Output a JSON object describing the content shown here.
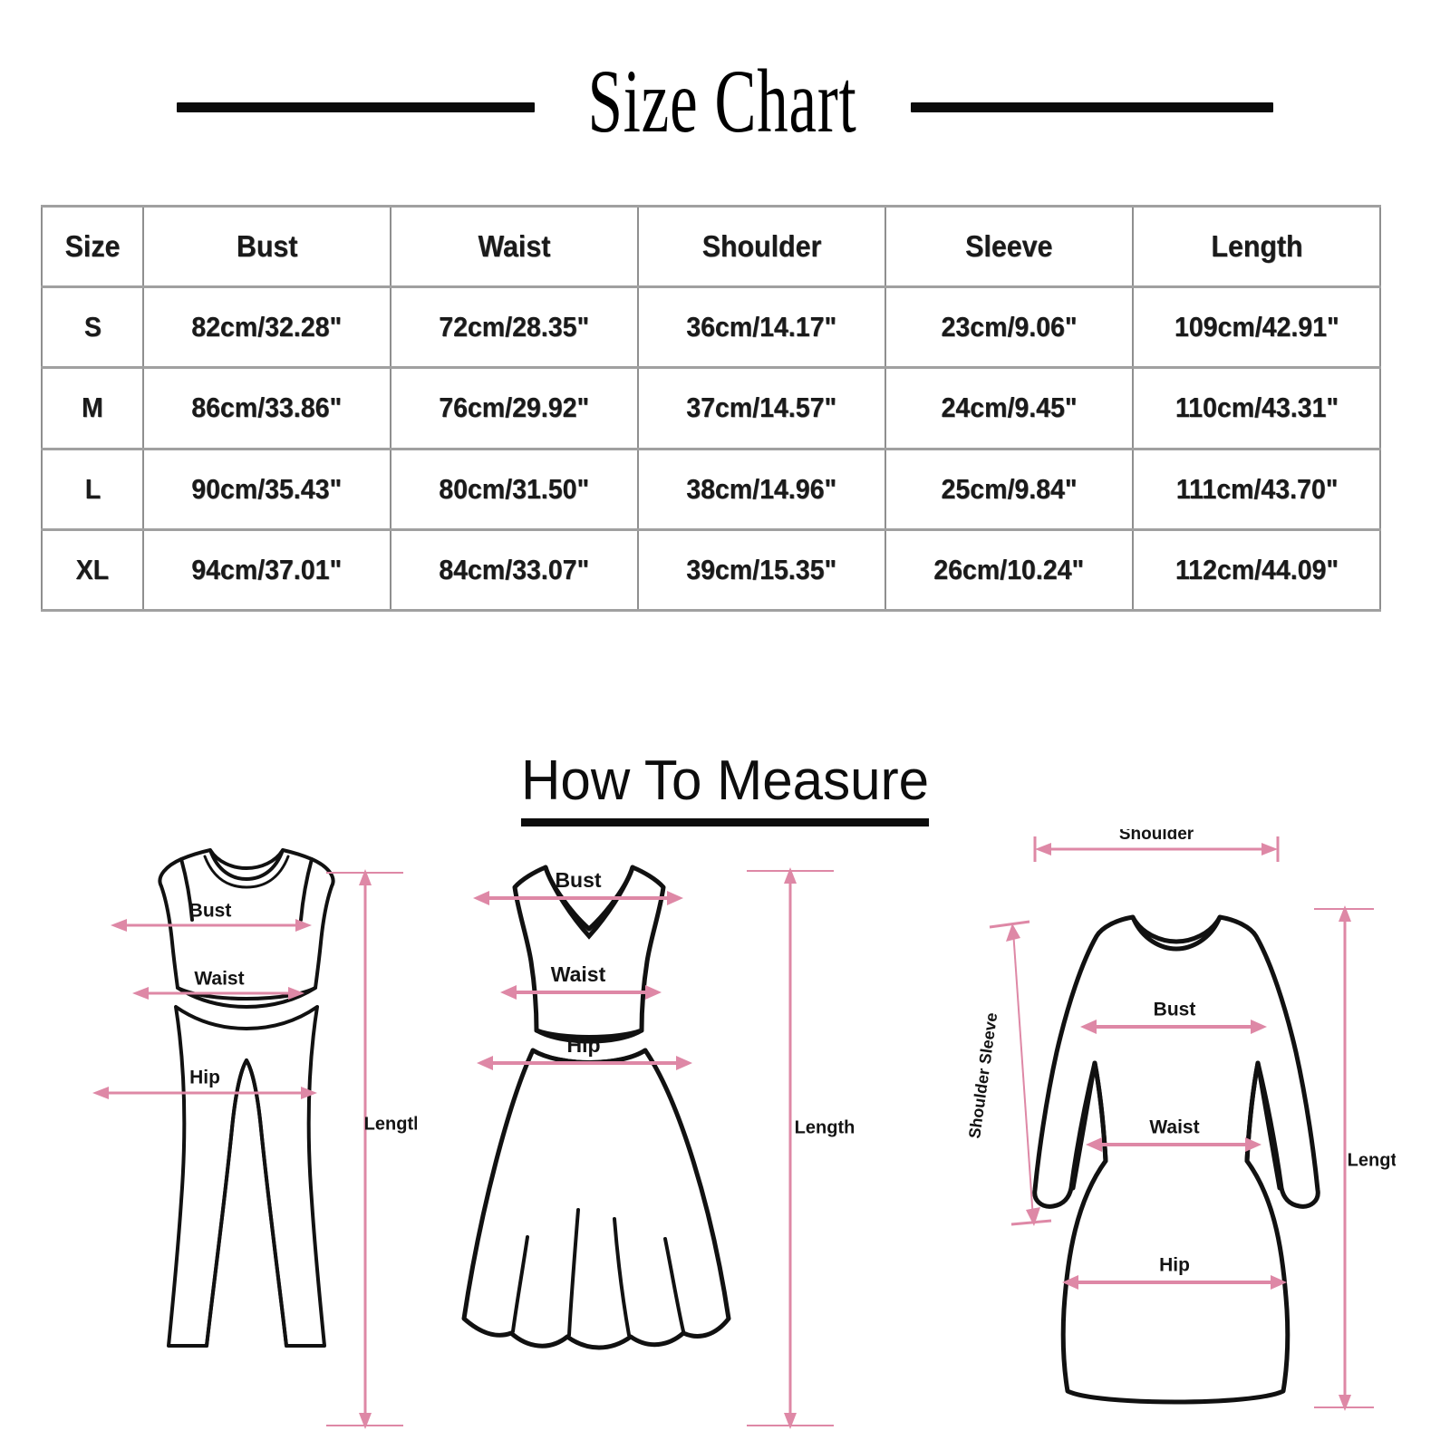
{
  "page": {
    "title": "Size Chart",
    "howto_title": "How To Measure",
    "accent_pink": "#de88a6",
    "ink": "#111111",
    "grid_color": "#9a9a9a"
  },
  "size_table": {
    "columns": [
      "Size",
      "Bust",
      "Waist",
      "Shoulder",
      "Sleeve",
      "Length"
    ],
    "rows": [
      {
        "size": "S",
        "bust": "82cm/32.28\"",
        "waist": "72cm/28.35\"",
        "shoulder": "36cm/14.17\"",
        "sleeve": "23cm/9.06\"",
        "length": "109cm/42.91\""
      },
      {
        "size": "M",
        "bust": "86cm/33.86\"",
        "waist": "76cm/29.92\"",
        "shoulder": "37cm/14.57\"",
        "sleeve": "24cm/9.45\"",
        "length": "110cm/43.31\""
      },
      {
        "size": "L",
        "bust": "90cm/35.43\"",
        "waist": "80cm/31.50\"",
        "shoulder": "38cm/14.96\"",
        "sleeve": "25cm/9.84\"",
        "length": "111cm/43.70\""
      },
      {
        "size": "XL",
        "bust": "94cm/37.01\"",
        "waist": "84cm/33.07\"",
        "shoulder": "39cm/15.35\"",
        "sleeve": "26cm/10.24\"",
        "length": "112cm/44.09\""
      }
    ]
  },
  "figures": {
    "jumpsuit": {
      "name": "sleeveless-jumpsuit",
      "labels": {
        "bust": "Bust",
        "waist": "Waist",
        "hip": "Hip",
        "length": "Length"
      }
    },
    "dress": {
      "name": "flared-dress",
      "labels": {
        "bust": "Bust",
        "waist": "Waist",
        "hip": "Hip",
        "length": "Length"
      }
    },
    "tunic": {
      "name": "long-sleeve-tunic",
      "labels": {
        "shoulder": "Shoulder",
        "shoulder_sleeve": "Shoulder Sleeve",
        "bust": "Bust",
        "waist": "Waist",
        "hip": "Hip",
        "length": "Length"
      }
    }
  },
  "chart_data": {
    "type": "table",
    "title": "Size Chart",
    "categories": [
      "S",
      "M",
      "L",
      "XL"
    ],
    "columns": [
      "Size",
      "Bust",
      "Waist",
      "Shoulder",
      "Sleeve",
      "Length"
    ],
    "units": "cm / inches",
    "series": [
      {
        "name": "Bust",
        "values_cm": [
          82,
          86,
          90,
          94
        ],
        "values_in": [
          32.28,
          33.86,
          35.43,
          37.01
        ]
      },
      {
        "name": "Waist",
        "values_cm": [
          72,
          76,
          80,
          84
        ],
        "values_in": [
          28.35,
          29.92,
          31.5,
          33.07
        ]
      },
      {
        "name": "Shoulder",
        "values_cm": [
          36,
          37,
          38,
          39
        ],
        "values_in": [
          14.17,
          14.57,
          14.96,
          15.35
        ]
      },
      {
        "name": "Sleeve",
        "values_cm": [
          23,
          24,
          25,
          26
        ],
        "values_in": [
          9.06,
          9.45,
          9.84,
          10.24
        ]
      },
      {
        "name": "Length",
        "values_cm": [
          109,
          110,
          111,
          112
        ],
        "values_in": [
          42.91,
          43.31,
          43.7,
          44.09
        ]
      }
    ]
  }
}
